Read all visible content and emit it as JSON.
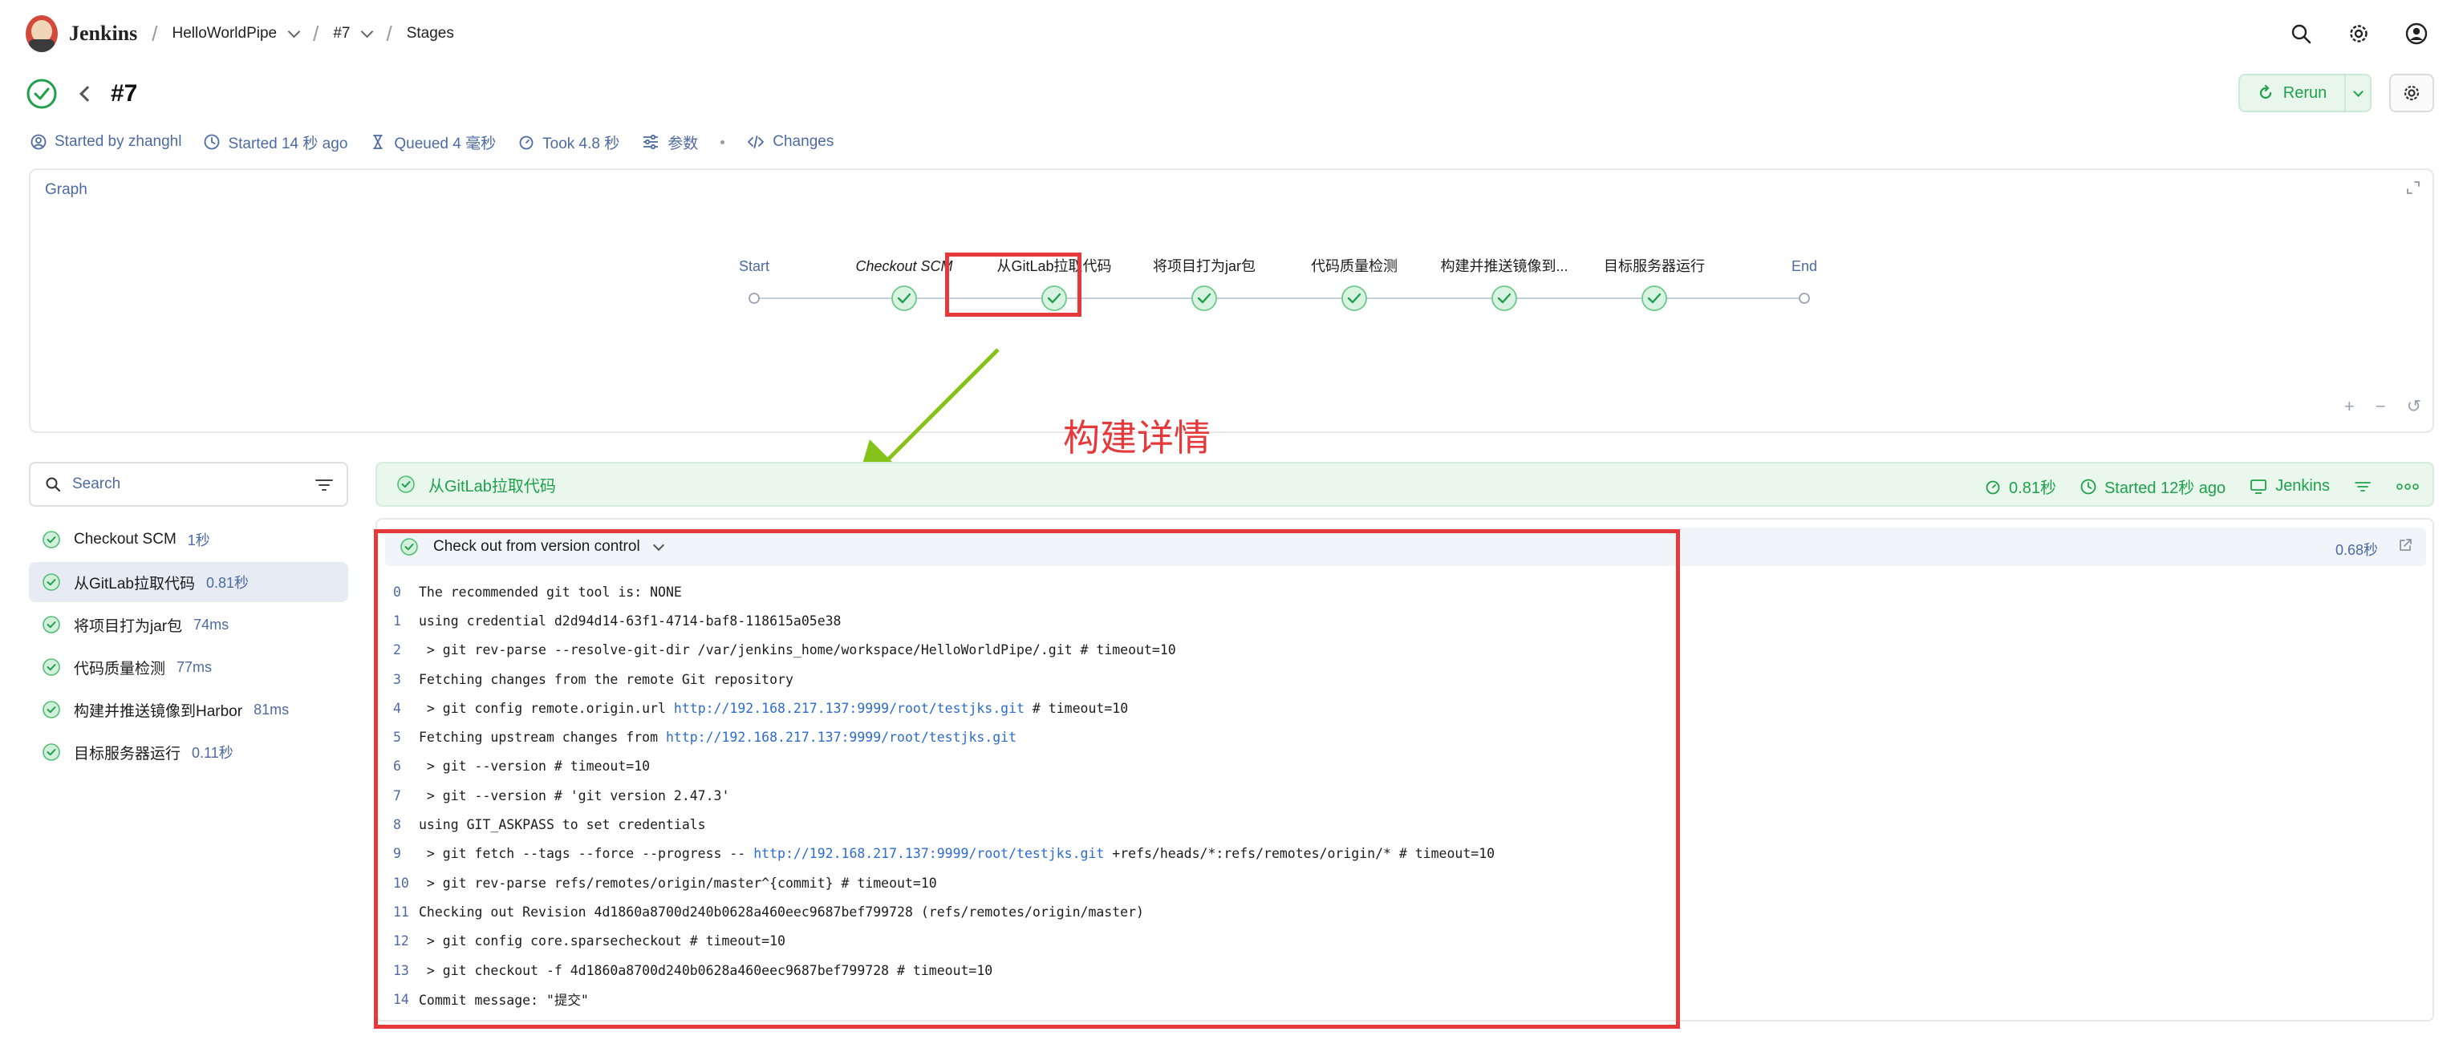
{
  "app": {
    "brand": "Jenkins",
    "breadcrumbs": [
      {
        "label": "HelloWorldPipe",
        "has_menu": true
      },
      {
        "label": "#7",
        "has_menu": true
      },
      {
        "label": "Stages",
        "has_menu": false
      }
    ],
    "top_icons": [
      "search-icon",
      "settings-icon",
      "account-icon"
    ]
  },
  "build": {
    "title": "#7",
    "status": "success",
    "rerun_label": "Rerun",
    "meta": {
      "started_by": "Started by zhanghl",
      "started": "Started 14 秒 ago",
      "queued": "Queued 4 毫秒",
      "took": "Took 4.8 秒",
      "params": "参数",
      "changes": "Changes"
    }
  },
  "graph": {
    "title": "Graph",
    "nodes": [
      {
        "label": "Start",
        "kind": "endpoint"
      },
      {
        "label": "Checkout SCM",
        "kind": "stage"
      },
      {
        "label": "从GitLab拉取代码",
        "kind": "stage"
      },
      {
        "label": "将项目打为jar包",
        "kind": "stage"
      },
      {
        "label": "代码质量检测",
        "kind": "stage"
      },
      {
        "label": "构建并推送镜像到...",
        "kind": "stage"
      },
      {
        "label": "目标服务器运行",
        "kind": "stage"
      },
      {
        "label": "End",
        "kind": "endpoint"
      }
    ],
    "controls": [
      "+",
      "−",
      "↺"
    ]
  },
  "annotation": {
    "text": "构建详情",
    "color": "#e5393b",
    "arrow_color": "#86c31a"
  },
  "sidebar": {
    "search_placeholder": "Search",
    "stages": [
      {
        "name": "Checkout SCM",
        "duration": "1秒",
        "active": false
      },
      {
        "name": "从GitLab拉取代码",
        "duration": "0.81秒",
        "active": true
      },
      {
        "name": "将项目打为jar包",
        "duration": "74ms",
        "active": false
      },
      {
        "name": "代码质量检测",
        "duration": "77ms",
        "active": false
      },
      {
        "name": "构建并推送镜像到Harbor",
        "duration": "81ms",
        "active": false
      },
      {
        "name": "目标服务器运行",
        "duration": "0.11秒",
        "active": false
      }
    ]
  },
  "stage_detail": {
    "name": "从GitLab拉取代码",
    "duration": "0.81秒",
    "started": "Started 12秒 ago",
    "agent": "Jenkins"
  },
  "step": {
    "name": "Check out from version control",
    "duration": "0.68秒",
    "log": [
      {
        "n": "0",
        "parts": [
          {
            "t": "The recommended git tool is: NONE"
          }
        ]
      },
      {
        "n": "1",
        "parts": [
          {
            "t": "using credential d2d94d14-63f1-4714-baf8-118615a05e38"
          }
        ]
      },
      {
        "n": "2",
        "parts": [
          {
            "t": " > git rev-parse --resolve-git-dir /var/jenkins_home/workspace/HelloWorldPipe/.git # timeout=10"
          }
        ]
      },
      {
        "n": "3",
        "parts": [
          {
            "t": "Fetching changes from the remote Git repository"
          }
        ]
      },
      {
        "n": "4",
        "parts": [
          {
            "t": " > git config remote.origin.url "
          },
          {
            "t": "http://192.168.217.137:9999/root/testjks.git",
            "url": true
          },
          {
            "t": " # timeout=10"
          }
        ]
      },
      {
        "n": "5",
        "parts": [
          {
            "t": "Fetching upstream changes from "
          },
          {
            "t": "http://192.168.217.137:9999/root/testjks.git",
            "url": true
          }
        ]
      },
      {
        "n": "6",
        "parts": [
          {
            "t": " > git --version # timeout=10"
          }
        ]
      },
      {
        "n": "7",
        "parts": [
          {
            "t": " > git --version # 'git version 2.47.3'"
          }
        ]
      },
      {
        "n": "8",
        "parts": [
          {
            "t": "using GIT_ASKPASS to set credentials"
          }
        ]
      },
      {
        "n": "9",
        "parts": [
          {
            "t": " > git fetch --tags --force --progress -- "
          },
          {
            "t": "http://192.168.217.137:9999/root/testjks.git",
            "url": true
          },
          {
            "t": " +refs/heads/*:refs/remotes/origin/* # timeout=10"
          }
        ]
      },
      {
        "n": "10",
        "parts": [
          {
            "t": " > git rev-parse refs/remotes/origin/master^{commit} # timeout=10"
          }
        ]
      },
      {
        "n": "11",
        "parts": [
          {
            "t": "Checking out Revision 4d1860a8700d240b0628a460eec9687bef799728 (refs/remotes/origin/master)"
          }
        ]
      },
      {
        "n": "12",
        "parts": [
          {
            "t": " > git config core.sparsecheckout # timeout=10"
          }
        ]
      },
      {
        "n": "13",
        "parts": [
          {
            "t": " > git checkout -f 4d1860a8700d240b0628a460eec9687bef799728 # timeout=10"
          }
        ]
      },
      {
        "n": "14",
        "parts": [
          {
            "t": "Commit message: \"提交\""
          }
        ]
      }
    ]
  },
  "colors": {
    "success": "#1ea14a",
    "success_bg": "#e9f7ed",
    "link": "#4d6aa3",
    "log_url": "#2c6bd1"
  }
}
